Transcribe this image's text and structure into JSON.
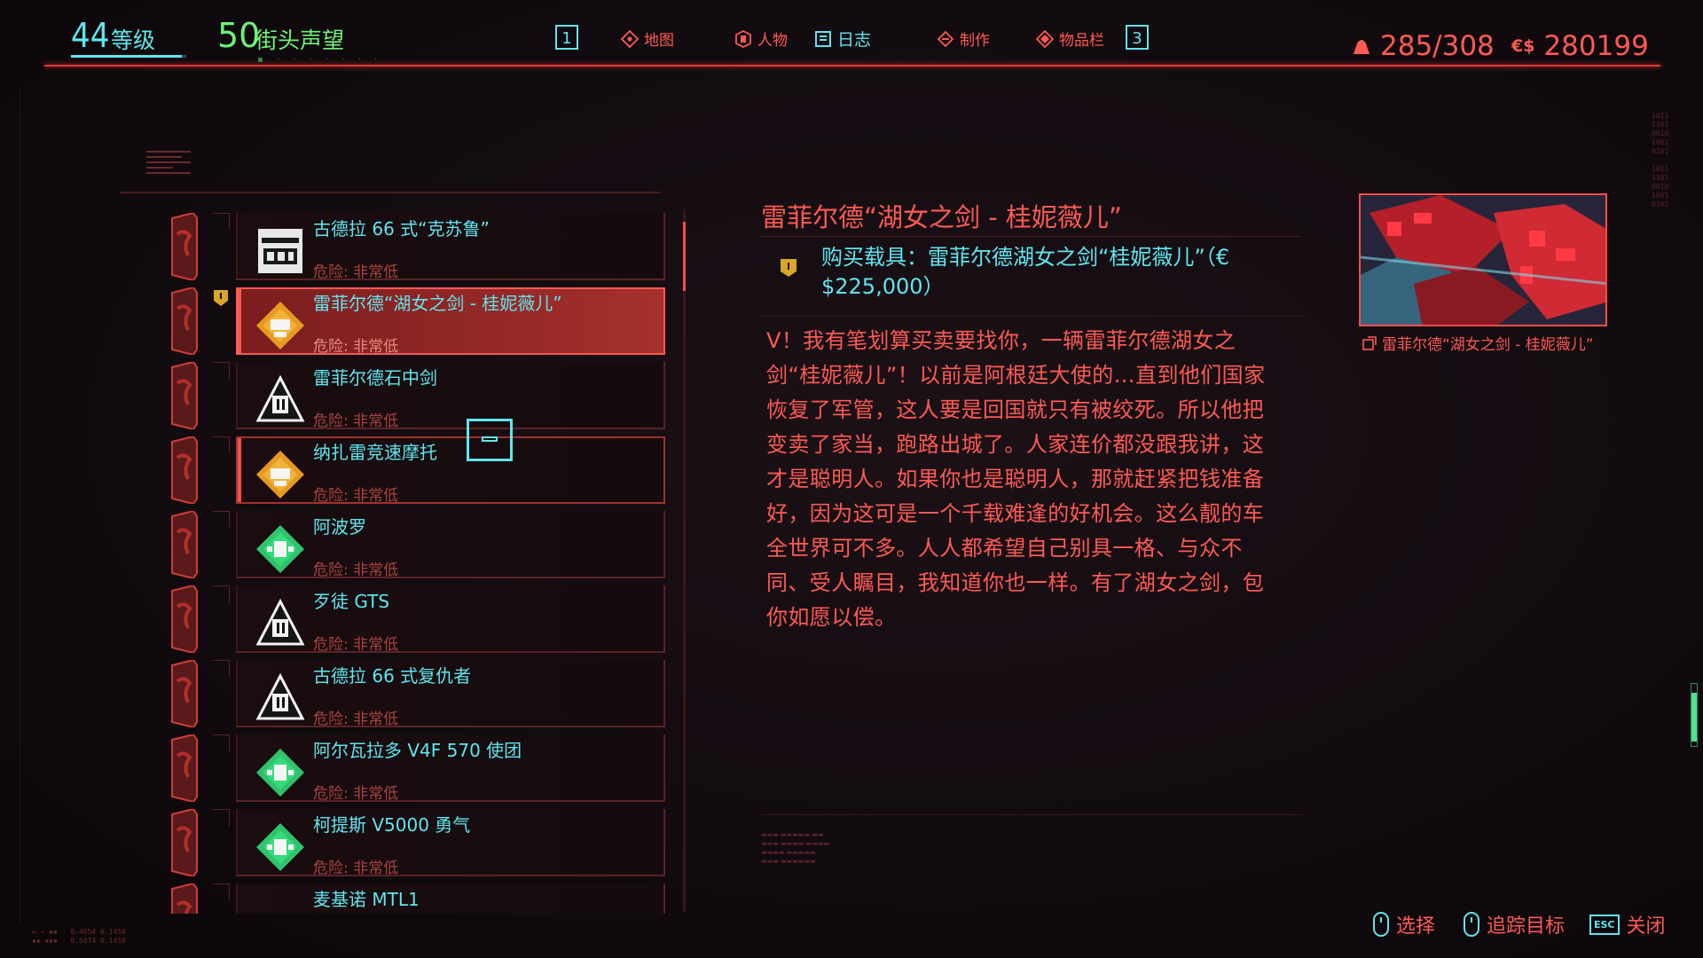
{
  "header": {
    "level": {
      "value": "44",
      "label": "等级"
    },
    "street_cred": {
      "value": "50",
      "label": "街头声望"
    },
    "key_left": "1",
    "key_right": "3",
    "nav": [
      {
        "label": "地图",
        "icon": "map-icon"
      },
      {
        "label": "人物",
        "icon": "character-icon"
      },
      {
        "label": "日志",
        "icon": "journal-icon",
        "active": true
      },
      {
        "label": "制作",
        "icon": "crafting-icon"
      },
      {
        "label": "物品栏",
        "icon": "inventory-icon"
      }
    ],
    "weight": "285/308",
    "money_symbol": "€$",
    "money": "280199"
  },
  "jobs": [
    {
      "title": "古德拉 66 式“克苏鲁”",
      "risk": "危险: 非常低",
      "faction": "watson-icon"
    },
    {
      "title": "雷菲尔德“湖女之剑 - 桂妮薇儿”",
      "risk": "危险: 非常低",
      "faction": "wb-icon",
      "selected": true
    },
    {
      "title": "雷菲尔德石中剑",
      "risk": "危险: 非常低",
      "faction": "centep-icon"
    },
    {
      "title": "纳扎雷竞速摩托",
      "risk": "危险: 非常低",
      "faction": "wb-icon",
      "tracked": true
    },
    {
      "title": "阿波罗",
      "risk": "危险: 非常低",
      "faction": "hw-icon"
    },
    {
      "title": "歹徒 GTS",
      "risk": "危险: 非常低",
      "faction": "centep-icon"
    },
    {
      "title": "古德拉 66 式复仇者",
      "risk": "危险: 非常低",
      "faction": "centep-icon"
    },
    {
      "title": "阿尔瓦拉多 V4F 570 使团",
      "risk": "危险: 非常低",
      "faction": "hw-icon"
    },
    {
      "title": "柯提斯 V5000 勇气",
      "risk": "危险: 非常低",
      "faction": "hw-icon"
    },
    {
      "title": "麦基诺 MTL1",
      "risk": "",
      "faction": ""
    }
  ],
  "detail": {
    "title": "雷菲尔德“湖女之剑 - 桂妮薇儿”",
    "objective": "购买载具：雷菲尔德湖女之剑“桂妮薇儿”（€$225,000）",
    "body": "V！我有笔划算买卖要找你，一辆雷菲尔德湖女之剑“桂妮薇儿”！以前是阿根廷大使的…直到他们国家恢复了军管，这人要是回国就只有被绞死。所以他把变卖了家当，跑路出城了。人家连价都没跟我讲，这才是聪明人。如果你也是聪明人，那就赶紧把钱准备好，因为这可是一个千载难逢的好机会。这么靓的车全世界可不多。人人都希望自己别具一格、与众不同、受人瞩目，我知道你也一样。有了湖女之剑，包你如愿以偿。",
    "map_caption": "雷菲尔德“湖女之剑 - 桂妮薇儿”"
  },
  "hints": [
    {
      "label": "选择",
      "icon": "mouse-left-icon"
    },
    {
      "label": "追踪目标",
      "icon": "mouse-right-icon"
    },
    {
      "label": "关闭",
      "icon": "esc-key-icon",
      "key": "ESC"
    }
  ],
  "colors": {
    "accent_red": "#ff5a52",
    "cyan": "#5fe6ef",
    "green": "#6ef27a",
    "selected_bg": "#a5302d"
  }
}
